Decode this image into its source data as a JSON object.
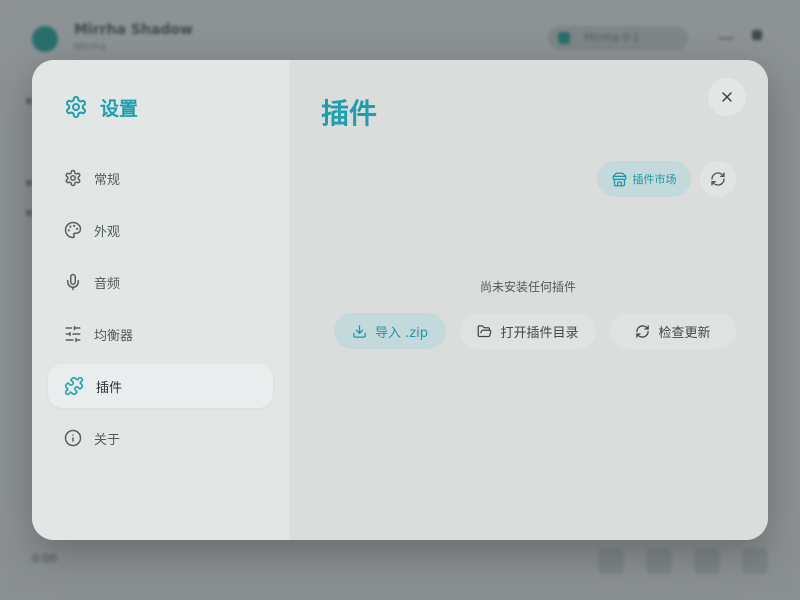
{
  "background": {
    "app_title": "Mirrha Shadow",
    "app_subtitle": "Mirrha",
    "status_pill": "Mirrha·0·1",
    "footer_text": "0:00"
  },
  "settings": {
    "title": "设置",
    "nav": [
      {
        "label": "常规",
        "icon": "gear-icon"
      },
      {
        "label": "外观",
        "icon": "palette-icon"
      },
      {
        "label": "音频",
        "icon": "microphone-icon"
      },
      {
        "label": "均衡器",
        "icon": "sliders-icon"
      },
      {
        "label": "插件",
        "icon": "puzzle-icon",
        "active": true
      },
      {
        "label": "关于",
        "icon": "info-icon"
      }
    ]
  },
  "plugins": {
    "page_title": "插件",
    "market_label": "插件市场",
    "empty_text": "尚未安装任何插件",
    "import_label": "导入 .zip",
    "open_dir_label": "打开插件目录",
    "check_update_label": "检查更新"
  },
  "colors": {
    "accent": "#1f9fae",
    "accent_bg": "#c3d9dc",
    "sidebar_bg": "#e2e7e6",
    "main_bg": "#dbdddd"
  }
}
